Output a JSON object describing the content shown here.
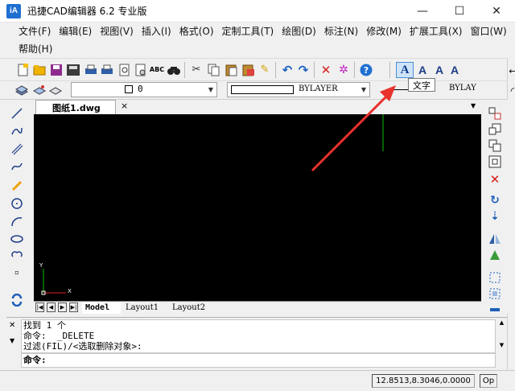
{
  "window": {
    "logo": "iA",
    "title": "迅捷CAD编辑器 6.2 专业版",
    "minimize": "—",
    "maximize": "☐",
    "close": "✕"
  },
  "menu": [
    "文件(F)",
    "编辑(E)",
    "视图(V)",
    "插入(I)",
    "格式(O)",
    "定制工具(T)",
    "绘图(D)",
    "标注(N)",
    "修改(M)",
    "扩展工具(X)",
    "窗口(W)",
    "帮助(H)"
  ],
  "toolbar": {
    "layer_value": "0",
    "color_value": "BYLAYER",
    "linetype_value": "BYLAY",
    "tooltip": "文字",
    "text_button": "A"
  },
  "document": {
    "tab_title": "图纸1.dwg",
    "close": "×",
    "layout_tabs": [
      "Model",
      "Layout1",
      "Layout2"
    ]
  },
  "ucs": {
    "y": "Y",
    "x": "X"
  },
  "command": {
    "history": [
      "找到 1 个",
      "命令:  _DELETE",
      "过滤(FIL)/<选取删除对象>:"
    ],
    "prompt": "命令:"
  },
  "status": {
    "coords": "12.8513,8.3046,0.0000",
    "op": "Op"
  },
  "colors": {
    "canvas": "#000000",
    "annotation_arrow": "#e8322b",
    "crosshair": "#00c000"
  }
}
